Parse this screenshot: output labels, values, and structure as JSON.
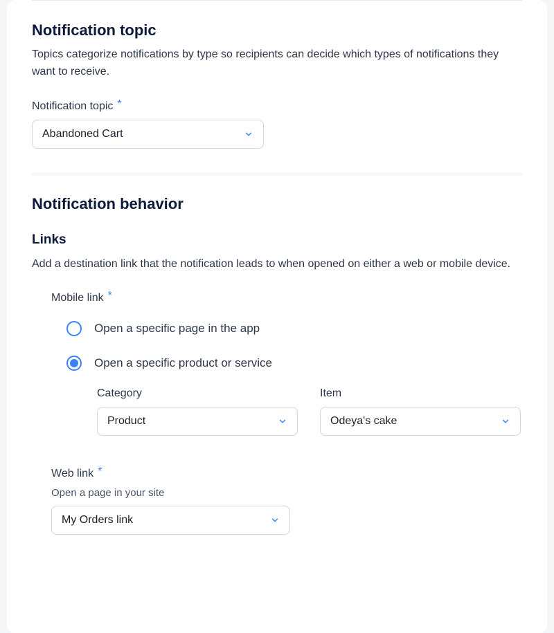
{
  "notification_topic": {
    "title": "Notification topic",
    "description": "Topics categorize notifications by type so recipients can decide which types of notifications they want to receive.",
    "field_label": "Notification topic",
    "required_indicator": "*",
    "selected_value": "Abandoned Cart"
  },
  "notification_behavior": {
    "title": "Notification behavior",
    "links": {
      "title": "Links",
      "description": "Add a destination link that the notification leads to when opened on either a web or mobile device.",
      "mobile_link": {
        "label": "Mobile link",
        "required_indicator": "*",
        "options": [
          {
            "label": "Open a specific page in the app",
            "selected": false
          },
          {
            "label": "Open a specific product or service",
            "selected": true
          }
        ],
        "category": {
          "label": "Category",
          "value": "Product"
        },
        "item": {
          "label": "Item",
          "value": "Odeya's cake"
        }
      },
      "web_link": {
        "label": "Web link",
        "required_indicator": "*",
        "sublabel": "Open a page in your site",
        "value": "My Orders link"
      }
    }
  }
}
